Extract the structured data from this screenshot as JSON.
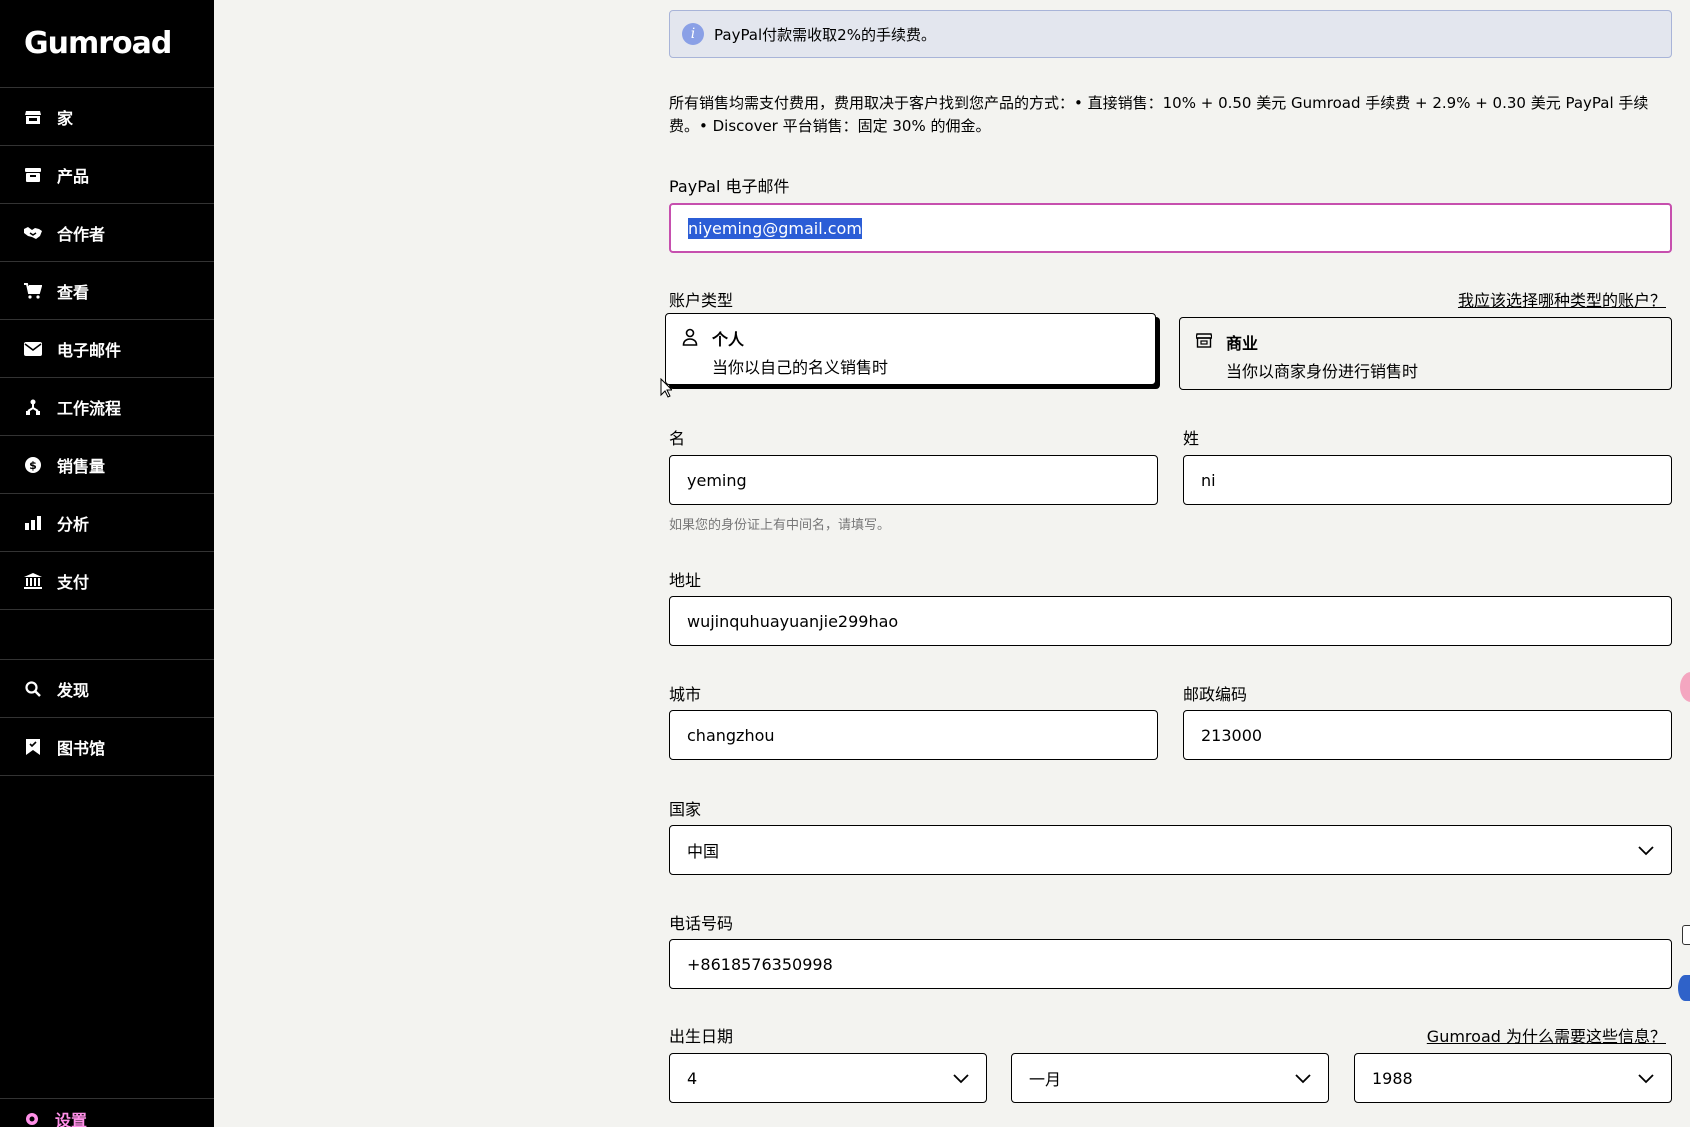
{
  "brand": {
    "logo": "Gumroad"
  },
  "sidebar": {
    "items": [
      {
        "label": "家",
        "icon": "store-icon"
      },
      {
        "label": "产品",
        "icon": "archive-icon"
      },
      {
        "label": "合作者",
        "icon": "handshake-icon"
      },
      {
        "label": "查看",
        "icon": "cart-icon"
      },
      {
        "label": "电子邮件",
        "icon": "envelope-icon"
      },
      {
        "label": "工作流程",
        "icon": "workflow-icon"
      },
      {
        "label": "销售量",
        "icon": "dollar-icon"
      },
      {
        "label": "分析",
        "icon": "bar-chart-icon"
      },
      {
        "label": "支付",
        "icon": "bank-icon"
      }
    ],
    "secondary": [
      {
        "label": "发现",
        "icon": "search-icon"
      },
      {
        "label": "图书馆",
        "icon": "bookmark-icon"
      }
    ],
    "settings": {
      "label": "设置",
      "icon": "gear-icon"
    }
  },
  "form": {
    "notice": "PayPal付款需收取2%的手续费。",
    "description": "所有销售均需支付费用，费用取决于客户找到您产品的方式：• 直接销售：10% + 0.50 美元 Gumroad 手续费 + 2.9% + 0.30 美元 PayPal 手续费。• Discover 平台销售：固定 30% 的佣金。",
    "paypal_email": {
      "label": "PayPal 电子邮件",
      "value": "niyeming@gmail.com"
    },
    "account_type": {
      "label": "账户类型",
      "help_link": "我应该选择哪种类型的账户？",
      "options": [
        {
          "title": "个人",
          "subtitle": "当你以自己的名义销售时",
          "icon": "user-icon",
          "selected": true
        },
        {
          "title": "商业",
          "subtitle": "当你以商家身份进行销售时",
          "icon": "store-icon",
          "selected": false
        }
      ]
    },
    "first_name": {
      "label": "名",
      "value": "yeming"
    },
    "last_name": {
      "label": "姓",
      "value": "ni"
    },
    "middle_name_hint": "如果您的身份证上有中间名，请填写。",
    "address": {
      "label": "地址",
      "value": "wujinquhuayuanjie299hao"
    },
    "city": {
      "label": "城市",
      "value": "changzhou"
    },
    "zip": {
      "label": "邮政编码",
      "value": "213000"
    },
    "country": {
      "label": "国家",
      "value": "中国"
    },
    "phone": {
      "label": "电话号码",
      "value": "+8618576350998"
    },
    "dob": {
      "label": "出生日期",
      "help_link": "Gumroad 为什么需要这些信息？",
      "day": "4",
      "month": "一月",
      "year": "1988"
    }
  }
}
